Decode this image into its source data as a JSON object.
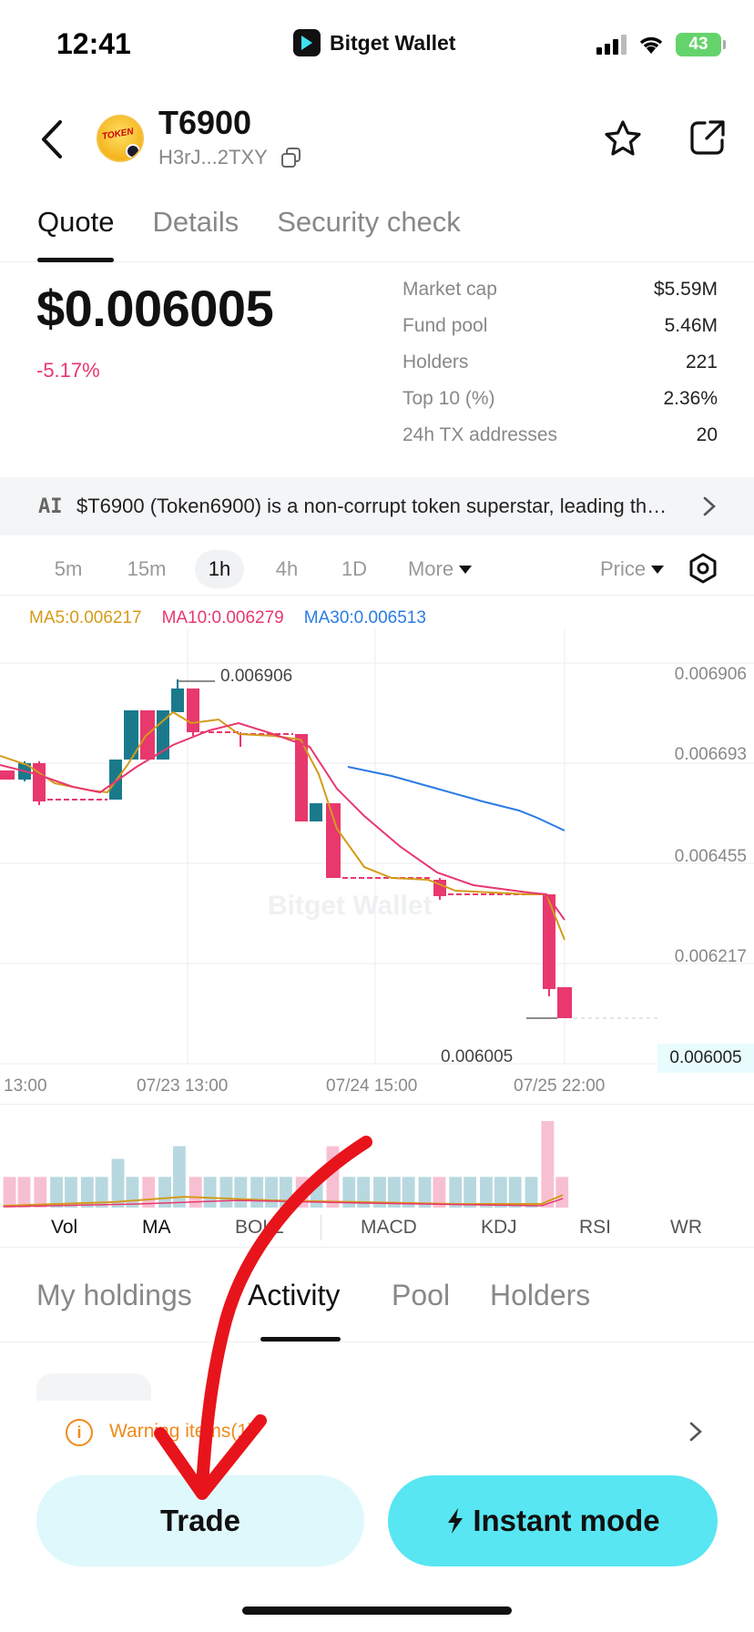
{
  "status": {
    "time": "12:41",
    "brand": "Bitget Wallet",
    "battery": "43"
  },
  "header": {
    "token_name": "T6900",
    "token_address": "H3rJ...2TXY",
    "logo_text": "TOKEN"
  },
  "tabs": [
    {
      "label": "Quote",
      "active": true
    },
    {
      "label": "Details",
      "active": false
    },
    {
      "label": "Security check",
      "active": false
    }
  ],
  "quote": {
    "price": "$0.006005",
    "change": "-5.17%",
    "stats": [
      {
        "label": "Market cap",
        "value": "$5.59M"
      },
      {
        "label": "Fund pool",
        "value": "5.46M"
      },
      {
        "label": "Holders",
        "value": "221"
      },
      {
        "label": "Top 10 (%)",
        "value": "2.36%"
      },
      {
        "label": "24h TX addresses",
        "value": "20"
      }
    ]
  },
  "ai": {
    "badge": "AI",
    "text": "$T6900 (Token6900) is a non-corrupt token superstar, leading the charge against corruption in crypto..."
  },
  "intervals": {
    "items": [
      "5m",
      "15m",
      "1h",
      "4h",
      "1D"
    ],
    "active": "1h",
    "more": "More",
    "price_mode": "Price"
  },
  "ma_legend": {
    "ma5": "MA5:0.006217",
    "ma10": "MA10:0.006279",
    "ma30": "MA30:0.006513",
    "colors": {
      "ma5": "#d49b1b",
      "ma10": "#e8386e",
      "ma30": "#2a7be4"
    }
  },
  "chart_data": {
    "type": "candlestick",
    "y_ticks": [
      "0.006906",
      "0.006693",
      "0.006455",
      "0.006217",
      "0.006005"
    ],
    "x_ticks": [
      "13:00",
      "07/23 13:00",
      "07/24 15:00",
      "07/25 22:00"
    ],
    "annotations": {
      "high": "0.006906",
      "last": "0.006005"
    },
    "colors": {
      "up": "#1a7a8c",
      "down": "#e8386e"
    },
    "watermark": "Bitget Wallet"
  },
  "indicators": {
    "items": [
      "Vol",
      "MA",
      "BOLL",
      "MACD",
      "KDJ",
      "RSI",
      "WR"
    ]
  },
  "bottom_tabs": [
    {
      "label": "My holdings",
      "active": false
    },
    {
      "label": "Activity",
      "active": true
    },
    {
      "label": "Pool",
      "active": false
    },
    {
      "label": "Holders",
      "active": false
    }
  ],
  "warning": {
    "text": "Warning items(1)",
    "icon": "info-icon"
  },
  "actions": {
    "trade": "Trade",
    "instant": "Instant mode"
  }
}
